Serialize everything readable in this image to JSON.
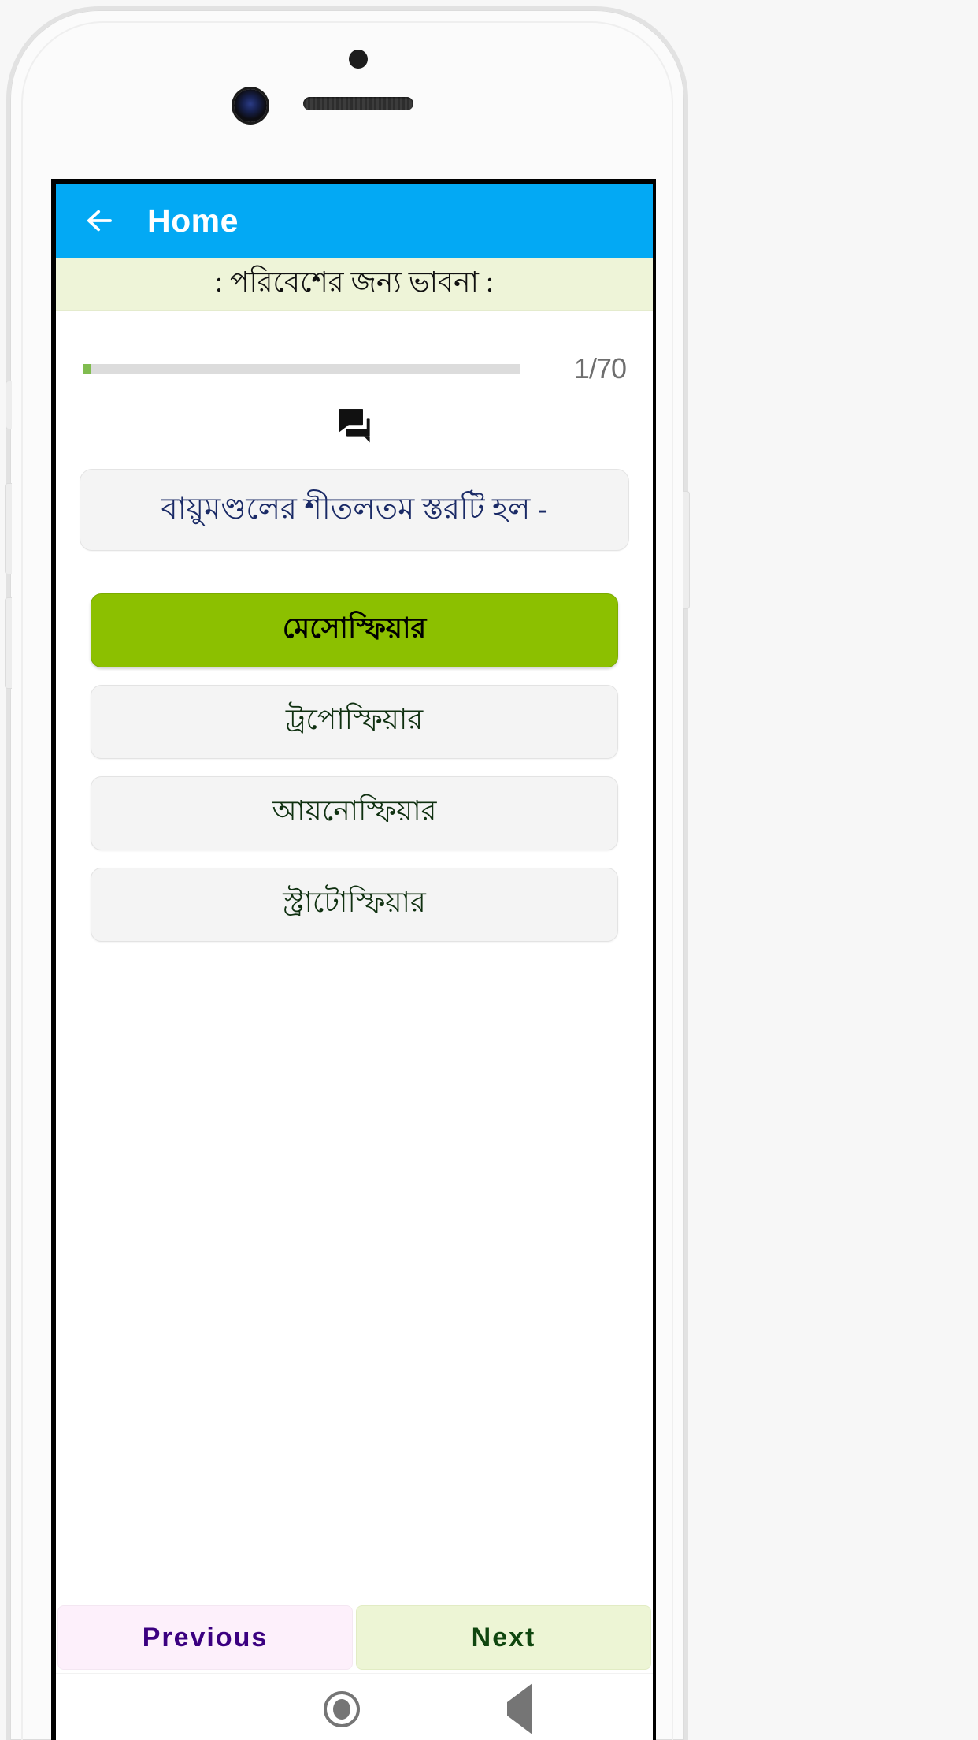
{
  "device": {
    "sensor_icon": "proximity-sensor-dot",
    "camera_icon": "front-camera-lens",
    "earpiece_icon": "earpiece-speaker-grille"
  },
  "appbar": {
    "back_icon": "back-arrow-icon",
    "title": "Home",
    "background_color": "#03A9F4",
    "title_color": "#FFFFFF"
  },
  "subtitle": {
    "text": ": পরিবেশের জন্য ভাবনা :",
    "background_color": "#EEF4D8"
  },
  "progress": {
    "label": "1/70",
    "current": 1,
    "total": 70,
    "percent": 1.43,
    "fill_color": "#80BC4F",
    "track_color": "#DCDCDC"
  },
  "quiz": {
    "icon": "question-answer-icon",
    "question": "বায়ুমণ্ডলের শীতলতম স্তরটি হল -",
    "question_color": "#1A2A66",
    "selected_index": 0,
    "selected_color": "#8CC000",
    "options": [
      {
        "label": "মেসোস্ফিয়ার",
        "selected": true
      },
      {
        "label": "ট্রপোস্ফিয়ার",
        "selected": false
      },
      {
        "label": "আয়নোস্ফিয়ার",
        "selected": false
      },
      {
        "label": "স্ট্রাটোস্ফিয়ার",
        "selected": false
      }
    ]
  },
  "footer": {
    "previous_label": "Previous",
    "previous_color": "#3B0080",
    "previous_bg": "#FDF0FB",
    "next_label": "Next",
    "next_color": "#10460F",
    "next_bg": "#EDF5D5"
  },
  "system_nav": {
    "recents_icon": "square-recents-icon",
    "home_icon": "circle-home-icon",
    "back_icon": "triangle-back-icon",
    "icon_color": "#757575"
  }
}
